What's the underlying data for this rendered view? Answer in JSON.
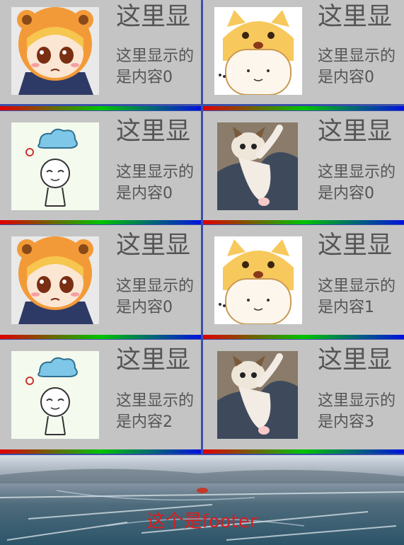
{
  "items": [
    {
      "title": "这里显",
      "content": "这里显示的是内容0",
      "icon": "anime-girl-image"
    },
    {
      "title": "这里显",
      "content": "这里显示的是内容0",
      "icon": "shiba-dog-image"
    },
    {
      "title": "这里显",
      "content": "这里显示的是内容0",
      "icon": "cloud-doodle-image"
    },
    {
      "title": "这里显",
      "content": "这里显示的是内容0",
      "icon": "kitten-image"
    },
    {
      "title": "这里显",
      "content": "这里显示的是内容0",
      "icon": "anime-girl-image"
    },
    {
      "title": "这里显",
      "content": "这里显示的是内容1",
      "icon": "shiba-dog-image"
    },
    {
      "title": "这里显",
      "content": "这里显示的是内容2",
      "icon": "cloud-doodle-image"
    },
    {
      "title": "这里显",
      "content": "这里显示的是内容3",
      "icon": "kitten-image"
    }
  ],
  "footer": {
    "label": "这个是footer",
    "image": "frozen-lake-landscape-image"
  },
  "colors": {
    "accent": "#3f51b5",
    "card_bg": "#c4c4c4",
    "text": "#555555",
    "footer_text": "#d81e1e",
    "gradient": [
      "#e00000",
      "#00c400",
      "#0010e0"
    ]
  }
}
